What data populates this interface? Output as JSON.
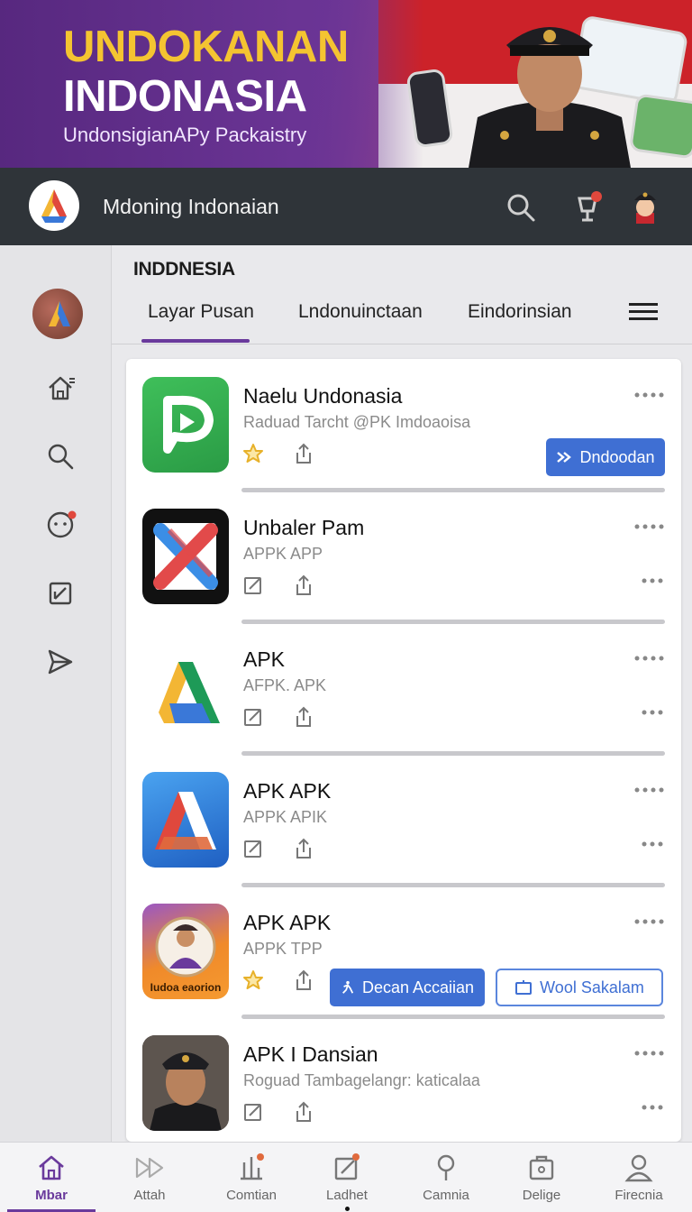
{
  "banner": {
    "title_line1": "UNDOKANAN",
    "title_line2": "INDONASIA",
    "subtitle": "UndonsigianAPy Packaistry"
  },
  "appbar": {
    "title": "Mdoning Indonaian",
    "notification_count": "1"
  },
  "section": {
    "title": "INDDNESIA",
    "tabs": [
      {
        "label": "Layar Pusan",
        "active": true
      },
      {
        "label": "Lndonuinctaan",
        "active": false
      },
      {
        "label": "Eindorinsian",
        "active": false
      }
    ]
  },
  "apps": [
    {
      "name": "Naelu Undonasia",
      "subtitle": "Raduad Tarcht @PK Imdoaoisa",
      "icon": "play-d-icon",
      "primary_button": "Dndoodan"
    },
    {
      "name": "Unbaler Pam",
      "subtitle": "APPK APP",
      "icon": "x-cross-icon"
    },
    {
      "name": "APK",
      "subtitle": "AFPK. APK",
      "icon": "drive-a-icon"
    },
    {
      "name": "APK APK",
      "subtitle": "APPK APIK",
      "icon": "blue-a-icon"
    },
    {
      "name": "APK APK",
      "subtitle": "APPK TPP",
      "icon": "character-badge-icon",
      "icon_caption": "Iudoa eaorion",
      "primary_button": "Decan Accaiian",
      "outline_button": "Wool Sakalam"
    },
    {
      "name": "APK I Dansian",
      "subtitle": "Roguad Tambagelangr: katicalaa",
      "icon": "officer-photo-icon"
    }
  ],
  "bottom_nav": [
    {
      "label": "Mbar",
      "icon": "home-icon",
      "active": true
    },
    {
      "label": "Attah",
      "icon": "forward-icon",
      "active": false
    },
    {
      "label": "Comtian",
      "icon": "chart-icon",
      "active": false
    },
    {
      "label": "Ladhet",
      "icon": "edit-icon",
      "active": false
    },
    {
      "label": "Camnia",
      "icon": "pin-icon",
      "active": false
    },
    {
      "label": "Delige",
      "icon": "bag-icon",
      "active": false
    },
    {
      "label": "Firecnia",
      "icon": "person-icon",
      "active": false
    }
  ],
  "colors": {
    "accent": "#6a3a9c",
    "primary_button": "#3f6fd3",
    "appbar": "#2f3439",
    "banner_title": "#f4c431",
    "star": "#e7b12a"
  }
}
